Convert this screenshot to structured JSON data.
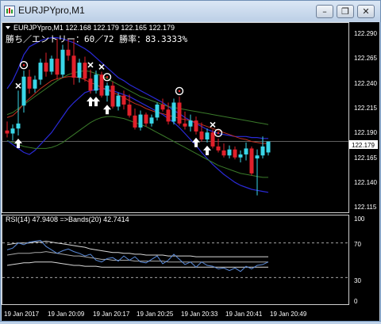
{
  "window": {
    "title": "EURJPYpro,M1",
    "buttons": [
      "minimize",
      "restore",
      "close"
    ]
  },
  "main_panel": {
    "header": "EURJPYpro,M1  122.168 122.179 122.165 122.179",
    "stats_text": "勝ち／エントリー：60／72 勝率：83.3333%",
    "current_price_label": "122.179",
    "price_axis": [
      "122.290",
      "122.265",
      "122.240",
      "122.215",
      "122.190",
      "122.165",
      "122.140",
      "122.115"
    ]
  },
  "rsi_panel": {
    "header": "RSI(14) 47.9408  =>Bands(20) 42.7414",
    "axis": [
      "100",
      "70",
      "30",
      "0"
    ]
  },
  "time_axis": [
    "19 Jan 2017",
    "19 Jan 20:09",
    "19 Jan 20:17",
    "19 Jan 20:25",
    "19 Jan 20:33",
    "19 Jan 20:41",
    "19 Jan 20:49"
  ],
  "colors": {
    "bull": "#3ad6e8",
    "bear": "#e0202a",
    "bb_outer": "#2a2ad8",
    "bb_mid": "#3a7a2a",
    "ma": "#c03020",
    "rsi": "#5a8ad8"
  },
  "chart_data": {
    "type": "candlestick",
    "symbol": "EURJPYpro",
    "timeframe": "M1",
    "candles": [
      {
        "o": 122.19,
        "h": 122.199,
        "l": 122.183,
        "c": 122.187
      },
      {
        "o": 122.187,
        "h": 122.196,
        "l": 122.18,
        "c": 122.192
      },
      {
        "o": 122.192,
        "h": 122.23,
        "l": 122.185,
        "c": 122.197
      },
      {
        "o": 122.215,
        "h": 122.25,
        "l": 122.208,
        "c": 122.244
      },
      {
        "o": 122.244,
        "h": 122.251,
        "l": 122.227,
        "c": 122.232
      },
      {
        "o": 122.232,
        "h": 122.245,
        "l": 122.228,
        "c": 122.241
      },
      {
        "o": 122.241,
        "h": 122.262,
        "l": 122.236,
        "c": 122.258
      },
      {
        "o": 122.258,
        "h": 122.268,
        "l": 122.244,
        "c": 122.249
      },
      {
        "o": 122.249,
        "h": 122.265,
        "l": 122.246,
        "c": 122.262
      },
      {
        "o": 122.262,
        "h": 122.282,
        "l": 122.241,
        "c": 122.246
      },
      {
        "o": 122.246,
        "h": 122.276,
        "l": 122.243,
        "c": 122.271
      },
      {
        "o": 122.271,
        "h": 122.282,
        "l": 122.26,
        "c": 122.265
      },
      {
        "o": 122.265,
        "h": 122.281,
        "l": 122.236,
        "c": 122.243
      },
      {
        "o": 122.243,
        "h": 122.262,
        "l": 122.238,
        "c": 122.258
      },
      {
        "o": 122.258,
        "h": 122.264,
        "l": 122.239,
        "c": 122.242
      },
      {
        "o": 122.242,
        "h": 122.251,
        "l": 122.227,
        "c": 122.23
      },
      {
        "o": 122.23,
        "h": 122.25,
        "l": 122.227,
        "c": 122.246
      },
      {
        "o": 122.246,
        "h": 122.249,
        "l": 122.223,
        "c": 122.225
      },
      {
        "o": 122.225,
        "h": 122.238,
        "l": 122.219,
        "c": 122.235
      },
      {
        "o": 122.235,
        "h": 122.239,
        "l": 122.212,
        "c": 122.214
      },
      {
        "o": 122.214,
        "h": 122.228,
        "l": 122.21,
        "c": 122.225
      },
      {
        "o": 122.225,
        "h": 122.23,
        "l": 122.211,
        "c": 122.216
      },
      {
        "o": 122.216,
        "h": 122.226,
        "l": 122.203,
        "c": 122.205
      },
      {
        "o": 122.205,
        "h": 122.212,
        "l": 122.191,
        "c": 122.193
      },
      {
        "o": 122.193,
        "h": 122.21,
        "l": 122.19,
        "c": 122.206
      },
      {
        "o": 122.206,
        "h": 122.208,
        "l": 122.194,
        "c": 122.197
      },
      {
        "o": 122.197,
        "h": 122.206,
        "l": 122.194,
        "c": 122.203
      },
      {
        "o": 122.203,
        "h": 122.218,
        "l": 122.2,
        "c": 122.216
      },
      {
        "o": 122.216,
        "h": 122.222,
        "l": 122.209,
        "c": 122.211
      },
      {
        "o": 122.211,
        "h": 122.218,
        "l": 122.196,
        "c": 122.199
      },
      {
        "o": 122.199,
        "h": 122.222,
        "l": 122.196,
        "c": 122.218
      },
      {
        "o": 122.218,
        "h": 122.224,
        "l": 122.195,
        "c": 122.197
      },
      {
        "o": 122.197,
        "h": 122.209,
        "l": 122.191,
        "c": 122.194
      },
      {
        "o": 122.194,
        "h": 122.206,
        "l": 122.189,
        "c": 122.2
      },
      {
        "o": 122.2,
        "h": 122.204,
        "l": 122.186,
        "c": 122.189
      },
      {
        "o": 122.189,
        "h": 122.198,
        "l": 122.179,
        "c": 122.181
      },
      {
        "o": 122.181,
        "h": 122.192,
        "l": 122.178,
        "c": 122.188
      },
      {
        "o": 122.188,
        "h": 122.191,
        "l": 122.172,
        "c": 122.174
      },
      {
        "o": 122.174,
        "h": 122.182,
        "l": 122.168,
        "c": 122.17
      },
      {
        "o": 122.17,
        "h": 122.177,
        "l": 122.163,
        "c": 122.165
      },
      {
        "o": 122.165,
        "h": 122.175,
        "l": 122.162,
        "c": 122.171
      },
      {
        "o": 122.171,
        "h": 122.174,
        "l": 122.161,
        "c": 122.163
      },
      {
        "o": 122.163,
        "h": 122.17,
        "l": 122.158,
        "c": 122.166
      },
      {
        "o": 122.166,
        "h": 122.178,
        "l": 122.16,
        "c": 122.172
      },
      {
        "o": 122.172,
        "h": 122.174,
        "l": 122.145,
        "c": 122.147
      },
      {
        "o": 122.162,
        "h": 122.171,
        "l": 122.125,
        "c": 122.165
      },
      {
        "o": 122.165,
        "h": 122.184,
        "l": 122.162,
        "c": 122.174
      },
      {
        "o": 122.168,
        "h": 122.179,
        "l": 122.165,
        "c": 122.179
      }
    ],
    "bb_upper": [
      122.232,
      122.24,
      122.252,
      122.266,
      122.274,
      122.277,
      122.28,
      122.282,
      122.283,
      122.283,
      122.282,
      122.28,
      122.278,
      122.275,
      122.272,
      122.268,
      122.263,
      122.258,
      122.253,
      122.248,
      122.243,
      122.24,
      122.236,
      122.233,
      122.23,
      122.227,
      122.224,
      122.221,
      122.218,
      122.214,
      122.21,
      122.207,
      122.203,
      122.2,
      122.197,
      122.194,
      122.191,
      122.189,
      122.187,
      122.186,
      122.185,
      122.184,
      122.184,
      122.184,
      122.183,
      122.183,
      122.182,
      122.182
    ],
    "bb_mid": [
      122.206,
      122.208,
      122.212,
      122.216,
      122.22,
      122.224,
      122.228,
      122.232,
      122.236,
      122.24,
      122.243,
      122.246,
      122.248,
      122.249,
      122.25,
      122.249,
      122.247,
      122.245,
      122.242,
      122.239,
      122.236,
      122.233,
      122.23,
      122.227,
      122.224,
      122.222,
      122.22,
      122.218,
      122.216,
      122.214,
      122.213,
      122.212,
      122.211,
      122.21,
      122.209,
      122.208,
      122.207,
      122.206,
      122.205,
      122.204,
      122.203,
      122.202,
      122.201,
      122.2,
      122.199,
      122.198,
      122.197,
      122.196
    ],
    "bb_lower": [
      122.18,
      122.176,
      122.172,
      122.168,
      122.166,
      122.17,
      122.176,
      122.182,
      122.188,
      122.196,
      122.204,
      122.212,
      122.218,
      122.223,
      122.228,
      122.23,
      122.231,
      122.232,
      122.231,
      122.23,
      122.228,
      122.226,
      122.224,
      122.221,
      122.218,
      122.215,
      122.212,
      122.209,
      122.206,
      122.202,
      122.198,
      122.193,
      122.187,
      122.181,
      122.175,
      122.168,
      122.162,
      122.156,
      122.151,
      122.146,
      122.142,
      122.138,
      122.135,
      122.133,
      122.131,
      122.13,
      122.129,
      122.128
    ],
    "ma": [
      122.203,
      122.205,
      122.21,
      122.217,
      122.222,
      122.227,
      122.232,
      122.236,
      122.24,
      122.242,
      122.243,
      122.244,
      122.244,
      122.243,
      122.241,
      122.238,
      122.236,
      122.233,
      122.231,
      122.228,
      122.226,
      122.223,
      122.22,
      122.217,
      122.215,
      122.212,
      122.21,
      122.208,
      122.207,
      122.205,
      122.204,
      122.202,
      122.201,
      122.2,
      122.198,
      122.196,
      122.194,
      122.192,
      122.19,
      122.188,
      122.186,
      122.184,
      122.182,
      122.181,
      122.179,
      122.178,
      122.177,
      122.177
    ],
    "bb_lower2": [
      122.18,
      122.178,
      122.176,
      122.174,
      122.173,
      122.172,
      122.172,
      122.172,
      122.173,
      122.175,
      122.178,
      122.182,
      122.186,
      122.19,
      122.194,
      122.198,
      122.201,
      122.203,
      122.204,
      122.204,
      122.203,
      122.202,
      122.2,
      122.198,
      122.196,
      122.194,
      122.191,
      122.188,
      122.185,
      122.182,
      122.179,
      122.176,
      122.173,
      122.17,
      122.167,
      122.164,
      122.161,
      122.158,
      122.155,
      122.153,
      122.151,
      122.149,
      122.147,
      122.146,
      122.145,
      122.144,
      122.143,
      122.143
    ],
    "markers": [
      {
        "i": 2,
        "type": "up"
      },
      {
        "i": 2,
        "type": "x"
      },
      {
        "i": 3,
        "type": "circle"
      },
      {
        "i": 15,
        "type": "up"
      },
      {
        "i": 16,
        "type": "up"
      },
      {
        "i": 15,
        "type": "x"
      },
      {
        "i": 17,
        "type": "x"
      },
      {
        "i": 18,
        "type": "up"
      },
      {
        "i": 18,
        "type": "circle"
      },
      {
        "i": 31,
        "type": "circle"
      },
      {
        "i": 34,
        "type": "up"
      },
      {
        "i": 36,
        "type": "up"
      },
      {
        "i": 37,
        "type": "x"
      },
      {
        "i": 38,
        "type": "circle"
      }
    ],
    "rsi": [
      62,
      64,
      70,
      68,
      71,
      72,
      73,
      66,
      62,
      58,
      61,
      63,
      60,
      58,
      55,
      57,
      50,
      48,
      52,
      53,
      49,
      55,
      50,
      54,
      48,
      47,
      51,
      55,
      46,
      50,
      57,
      51,
      45,
      48,
      42,
      48,
      44,
      43,
      40,
      41,
      38,
      41,
      37,
      43,
      40,
      44,
      45,
      48
    ],
    "rsi_band_upper": [
      68,
      69,
      70,
      70,
      70,
      71,
      71,
      72,
      71,
      70,
      69,
      68,
      67,
      66,
      65,
      63,
      62,
      61,
      60,
      59,
      59,
      58,
      58,
      57,
      57,
      56,
      56,
      56,
      56,
      55,
      55,
      55,
      55,
      55,
      54,
      54,
      54,
      54,
      54,
      54,
      54,
      54,
      54,
      54,
      54,
      54,
      54,
      54
    ],
    "rsi_band_lower": [
      44,
      45,
      46,
      47,
      47,
      48,
      48,
      48,
      48,
      47,
      46,
      45,
      44,
      44,
      43,
      43,
      43,
      42,
      42,
      42,
      42,
      42,
      42,
      42,
      42,
      42,
      42,
      42,
      42,
      42,
      42,
      42,
      42,
      42,
      42,
      42,
      42,
      42,
      42,
      42,
      42,
      42,
      42,
      42,
      42,
      42,
      42,
      42
    ],
    "rsi_band_mid": [
      56,
      57,
      58,
      58,
      58,
      59,
      59,
      60,
      59,
      58,
      57,
      56,
      55,
      55,
      54,
      53,
      52,
      51,
      51,
      50,
      50,
      50,
      50,
      49,
      49,
      49,
      49,
      49,
      49,
      48,
      48,
      48,
      48,
      48,
      48,
      48,
      48,
      48,
      48,
      48,
      48,
      48,
      48,
      48,
      48,
      48,
      48,
      48
    ],
    "price_ylim": [
      122.108,
      122.297
    ],
    "rsi_ylim": [
      0,
      100
    ]
  }
}
